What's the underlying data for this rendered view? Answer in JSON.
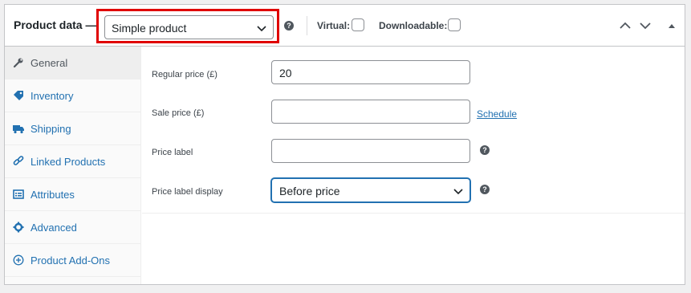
{
  "header": {
    "title": "Product data —",
    "product_type": "Simple product",
    "virtual_label": "Virtual:",
    "downloadable_label": "Downloadable:",
    "help_glyph": "?"
  },
  "sidebar": {
    "items": [
      {
        "label": "General",
        "icon": "wrench-icon"
      },
      {
        "label": "Inventory",
        "icon": "tag-icon"
      },
      {
        "label": "Shipping",
        "icon": "truck-icon"
      },
      {
        "label": "Linked Products",
        "icon": "link-icon"
      },
      {
        "label": "Attributes",
        "icon": "list-icon"
      },
      {
        "label": "Advanced",
        "icon": "gear-icon"
      },
      {
        "label": "Product Add-Ons",
        "icon": "plus-circle-icon"
      }
    ]
  },
  "general": {
    "regular_price_label": "Regular price (£)",
    "regular_price_value": "20",
    "sale_price_label": "Sale price (£)",
    "sale_price_value": "",
    "schedule_link": "Schedule",
    "price_label_label": "Price label",
    "price_label_value": "",
    "price_label_display_label": "Price label display",
    "price_label_display_value": "Before price"
  },
  "colors": {
    "highlight": "#e00000",
    "link": "#2271b1",
    "focus": "#2271b1"
  }
}
